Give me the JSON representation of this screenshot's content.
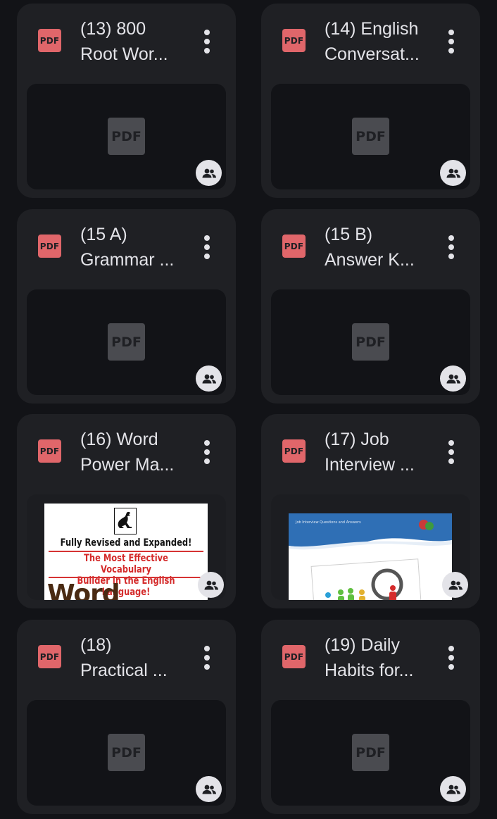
{
  "files": [
    {
      "line1": "(13) 800",
      "line2": "Root Wor...",
      "badge": "PDF",
      "thumb_label": "PDF"
    },
    {
      "line1": "(14) English",
      "line2": "Conversat...",
      "badge": "PDF",
      "thumb_label": "PDF"
    },
    {
      "line1": "(15 A)",
      "line2": "Grammar ...",
      "badge": "PDF",
      "thumb_label": "PDF"
    },
    {
      "line1": "(15 B)",
      "line2": "Answer K...",
      "badge": "PDF",
      "thumb_label": "PDF"
    },
    {
      "line1": "(16) Word",
      "line2": "Power Ma...",
      "badge": "PDF",
      "cover": {
        "line1": "Fully Revised and Expanded!",
        "line2a": "The Most Effective Vocabulary",
        "line2b": "Builder in the English Language!",
        "big": "Word Power"
      }
    },
    {
      "line1": "(17) Job",
      "line2": "Interview ...",
      "badge": "PDF",
      "cover2": {
        "header": "Job Interview Questions and Answers"
      }
    },
    {
      "line1": "(18)",
      "line2": "Practical ...",
      "badge": "PDF",
      "thumb_label": "PDF"
    },
    {
      "line1": "(19) Daily",
      "line2": "Habits for...",
      "badge": "PDF",
      "thumb_label": "PDF"
    }
  ],
  "colors": {
    "background": "#121317",
    "card": "#1f2024",
    "badge": "#e0666a",
    "text": "#e3e3e8"
  },
  "icons": {
    "menu": "more-vert-icon",
    "shared": "people-icon",
    "file": "pdf-icon"
  }
}
